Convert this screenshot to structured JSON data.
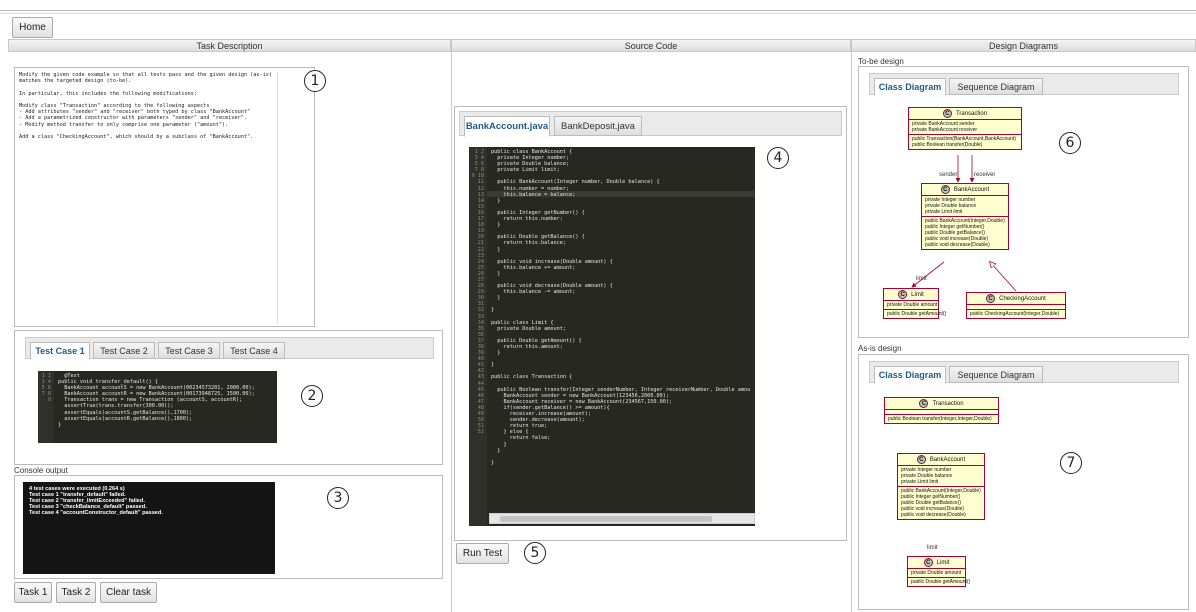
{
  "toolbar": {
    "home_label": "Home"
  },
  "columns": {
    "task": "Task Description",
    "source": "Source Code",
    "design": "Design Diagrams"
  },
  "task_description": {
    "lines": [
      "Modify the given code example so that all tests pass and the given design (as-is)",
      "matches the targeted design (to-be).",
      "",
      "In particular, this includes the following modifications:",
      "",
      "Modify class \"Transaction\" according to the following aspects",
      "- Add attributes \"sender\" and \"receiver\" both typed by class \"BankAccount\"",
      "- Add a parametrized constructor with parameters \"sender\" and \"receiver\".",
      "- Modify method transfer to only comprise one parameter (\"amount\").",
      "",
      "Add a class \"CheckingAccount\", which should by a subclass of \"BankAccount\"."
    ]
  },
  "test_cases": {
    "tabs": [
      "Test Case 1",
      "Test Case 2",
      "Test Case 3",
      "Test Case 4"
    ],
    "gutter": "1\n2\n3\n4\n5\n6\n7\n8\n9",
    "code": "  @Test\npublic void transfer_default() {\n  BankAccount accountS = new BankAccount(00234573201, 2000.00);\n  BankAccount accountR = new BankAccount(00173948725, 1500.00);\n  Transaction trans = new Transaction (accountS, accountR);\n  assertTrue(trans.transfer(300.00));\n  assertEquals(accountS.getBalance(),1700);\n  assertEquals(accountR.getBalance(),1800);\n}"
  },
  "console": {
    "label": "Console output",
    "text": "4 test cases were executed (0.264 s)\nTest case 1 \"transfer_default\" failed.\nTest case 2 \"transfer_limitExceeded\" failed.\nTest case 3 \"checkBalance_default\" passed.\nTest case 4 \"accountConstructor_default\" passed."
  },
  "bottom_buttons": {
    "task1": "Task 1",
    "task2": "Task 2",
    "clear": "Clear task"
  },
  "source": {
    "tabs": [
      "BankAccount.java",
      "BankDeposit.java"
    ],
    "gutter": "1\n2\n3\n4\n5\n6\n7\n8\n9\n10\n11\n12\n13\n14\n15\n16\n17\n18\n19\n20\n21\n22\n23\n24\n25\n26\n27\n28\n29\n30\n31\n32\n33\n34\n35\n36\n37\n38\n39\n40\n41\n42\n43\n44\n45\n46\n47\n48\n49\n50\n51\n52",
    "code": "public class BankAccount {\n  private Integer number;\n  private Double balance;\n  private Limit limit;\n\n  public BankAccount(Integer number, Double balance) {\n    this.number = number;\n    this.balance = balance;\n  }\n\n  public Integer getNumber() {\n    return this.number;\n  }\n\n  public Double getBalance() {\n    return this.balance;\n  }\n\n  public void increase(Double amount) {\n    this.balance += amount;\n  }\n\n  public void decrease(Double amount) {\n    this.balance -= amount;\n  }\n\n}\n\npublic class Limit {\n  private Double amount;\n\n  public Double getAmount() {\n    return this.amount;\n  }\n\n}\n\npublic class Transaction {\n\n  public Boolean transfer(Integer senderNumber, Integer receiverNumber, Double amou\n    BankAccount sender = new BankAccount(123456,2000.00);\n    BankAccount receiver = new BankAccount(234567,150.00);\n    if(sender.getBalance() >= amount){\n      receiver.increase(amount);\n      sender.decrease(amount);\n      return true;\n    } else {\n      return false;\n    }\n  }\n\n}",
    "run_label": "Run Test"
  },
  "design": {
    "tobe_label": "To-be design",
    "asis_label": "As-is design",
    "tabs": [
      "Class Diagram",
      "Sequence Diagram"
    ],
    "tobe": {
      "transaction": {
        "name": "Transaction",
        "attrs": "private BankAccount sender\nprivate BankAccount receiver",
        "methods": "public Transaction(BankAccount,BankAccount)\npublic Boolean transfer(Double)"
      },
      "bankaccount": {
        "name": "BankAccount",
        "attrs": "private Integer number\nprivate Double balance\nprivate Limit limit",
        "methods": "public BankAccount(Integer,Double)\npublic Integer getNumber()\npublic Double getBalance()\npublic void increase(Double)\npublic void decrease(Double)"
      },
      "limit": {
        "name": "Limit",
        "attrs": "private Double amount",
        "methods": "public Double getAmount()"
      },
      "checking": {
        "name": "CheckingAccount",
        "attrs": "",
        "methods": "public CheckingAccount(Integer,Double)"
      },
      "sender_label": "sender",
      "receiver_label": "receiver",
      "limit_label": "limit"
    },
    "asis": {
      "transaction": {
        "name": "Transaction",
        "attrs": "",
        "methods": "public Boolean transfer(Integer,Integer,Double)"
      },
      "bankaccount": {
        "name": "BankAccount",
        "attrs": "private Integer number\nprivate Double balance\nprivate Limit limit",
        "methods": "public BankAccount(Integer,Double)\npublic Integer getNumber()\npublic Double getBalance()\npublic void increase(Double)\npublic void decrease(Double)"
      },
      "limit": {
        "name": "Limit",
        "attrs": "private Double amount",
        "methods": "public Double getAmount()"
      },
      "limit_label": "limit"
    }
  },
  "markers": [
    "1",
    "2",
    "3",
    "4",
    "5",
    "6",
    "7"
  ]
}
